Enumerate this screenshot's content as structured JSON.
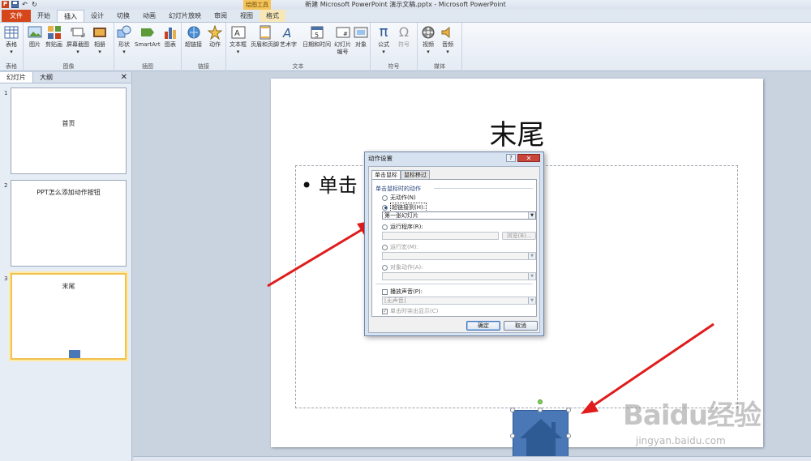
{
  "window": {
    "title": "新建 Microsoft PowerPoint 演示文稿.pptx - Microsoft PowerPoint",
    "contextual_tab_header": "绘图工具"
  },
  "ribbon_tabs": [
    "文件",
    "开始",
    "插入",
    "设计",
    "切换",
    "动画",
    "幻灯片放映",
    "审阅",
    "视图",
    "格式"
  ],
  "ribbon": {
    "groups": {
      "table": "表格",
      "images": "图像",
      "illustrations": "插图",
      "links": "链接",
      "text": "文本",
      "symbols": "符号",
      "media": "媒体"
    },
    "buttons": {
      "table": "表格",
      "picture": "图片",
      "clipart": "剪贴画",
      "screenshot": "屏幕截图",
      "album": "相册",
      "shapes": "形状",
      "smartart": "SmartArt",
      "chart": "图表",
      "hyperlink": "超链接",
      "action": "动作",
      "textbox": "文本框",
      "header_footer": "页眉和页脚",
      "wordart": "艺术字",
      "datetime": "日期和时间",
      "slide_number_1": "幻灯片",
      "slide_number_2": "编号",
      "object": "对象",
      "equation": "公式",
      "symbol": "符号",
      "video": "视频",
      "audio": "音频"
    }
  },
  "left_panel": {
    "tabs": [
      "幻灯片",
      "大纲"
    ],
    "close": "✕",
    "slides": [
      {
        "num": "1",
        "title": "首页"
      },
      {
        "num": "2",
        "title": "PPT怎么添加动作按钮"
      },
      {
        "num": "3",
        "title": "末尾"
      }
    ]
  },
  "slide": {
    "title": "末尾",
    "bullet": "• 单击"
  },
  "dialog": {
    "title": "动作设置",
    "help": "?",
    "close": "✕",
    "tabs": [
      "单击鼠标",
      "鼠标移过"
    ],
    "section_label": "单击鼠标时的动作",
    "options": {
      "none": "无动作(N)",
      "hyperlink": "超链接到(H):",
      "run_program": "运行程序(R):",
      "run_macro": "运行宏(M):",
      "object_action": "对象动作(A):"
    },
    "hyperlink_value": "第一张幻灯片",
    "browse": "浏览(B)...",
    "play_sound": "播放声音(P):",
    "sound_value": "[无声音]",
    "highlight": "单击时突出显示(C)",
    "ok": "确定",
    "cancel": "取消"
  },
  "watermark": {
    "brand": "Baidu经验",
    "url": "jingyan.baidu.com"
  },
  "colors": {
    "accent_file_tab": "#d5471b",
    "shape_fill": "#4a78b6",
    "arrow": "#e01c1c"
  }
}
